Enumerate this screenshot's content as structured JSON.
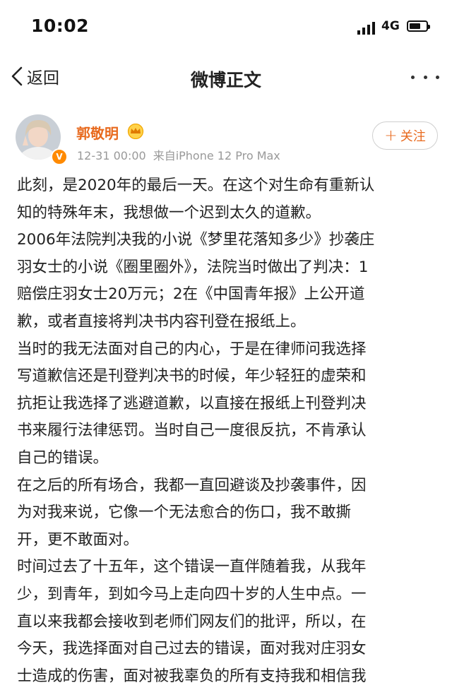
{
  "status_bar": {
    "time": "10:02",
    "network": "4G",
    "battery_percent": 70
  },
  "nav": {
    "back_label": "返回",
    "title": "微博正文"
  },
  "post": {
    "author_name": "郭敬明",
    "date": "12-31 00:00",
    "source": "来自iPhone 12 Pro Max",
    "follow_label": "关注",
    "lines": [
      "此刻，是2020年的最后一天。在这个对生命有重新认",
      "知的特殊年末，我想做一个迟到太久的道歉。",
      "2006年法院判决我的小说《梦里花落知多少》抄袭庄",
      "羽女士的小说《圈里圈外》，法院当时做出了判决：1",
      "赔偿庄羽女士20万元；2在《中国青年报》上公开道",
      "歉，或者直接将判决书内容刊登在报纸上。",
      "当时的我无法面对自己的内心，于是在律师问我选择",
      "写道歉信还是刊登判决书的时候，年少轻狂的虚荣和",
      "抗拒让我选择了逃避道歉，以直接在报纸上刊登判决",
      "书来履行法律惩罚。当时自己一度很反抗，不肯承认",
      "自己的错误。",
      "在之后的所有场合，我都一直回避谈及抄袭事件，因",
      "为对我来说，它像一个无法愈合的伤口，我不敢撕",
      "开，更不敢面对。",
      "时间过去了十五年，这个错误一直伴随着我，从我年",
      "少，到青年，到如今马上走向四十岁的人生中点。一",
      "直以来我都会接收到老师们网友们的批评，所以，在",
      "今天，我选择面对自己过去的错误，面对我对庄羽女",
      "士造成的伤害，面对被我辜负的所有支持我和相信我"
    ]
  },
  "colors": {
    "accent": "#e86a1e",
    "badge": "#ff8a00",
    "meta": "#999999"
  },
  "icons": [
    "signal-icon",
    "battery-icon",
    "back-chevron-icon",
    "more-icon",
    "verified-badge-icon",
    "crown-badge-icon",
    "plus-icon"
  ]
}
